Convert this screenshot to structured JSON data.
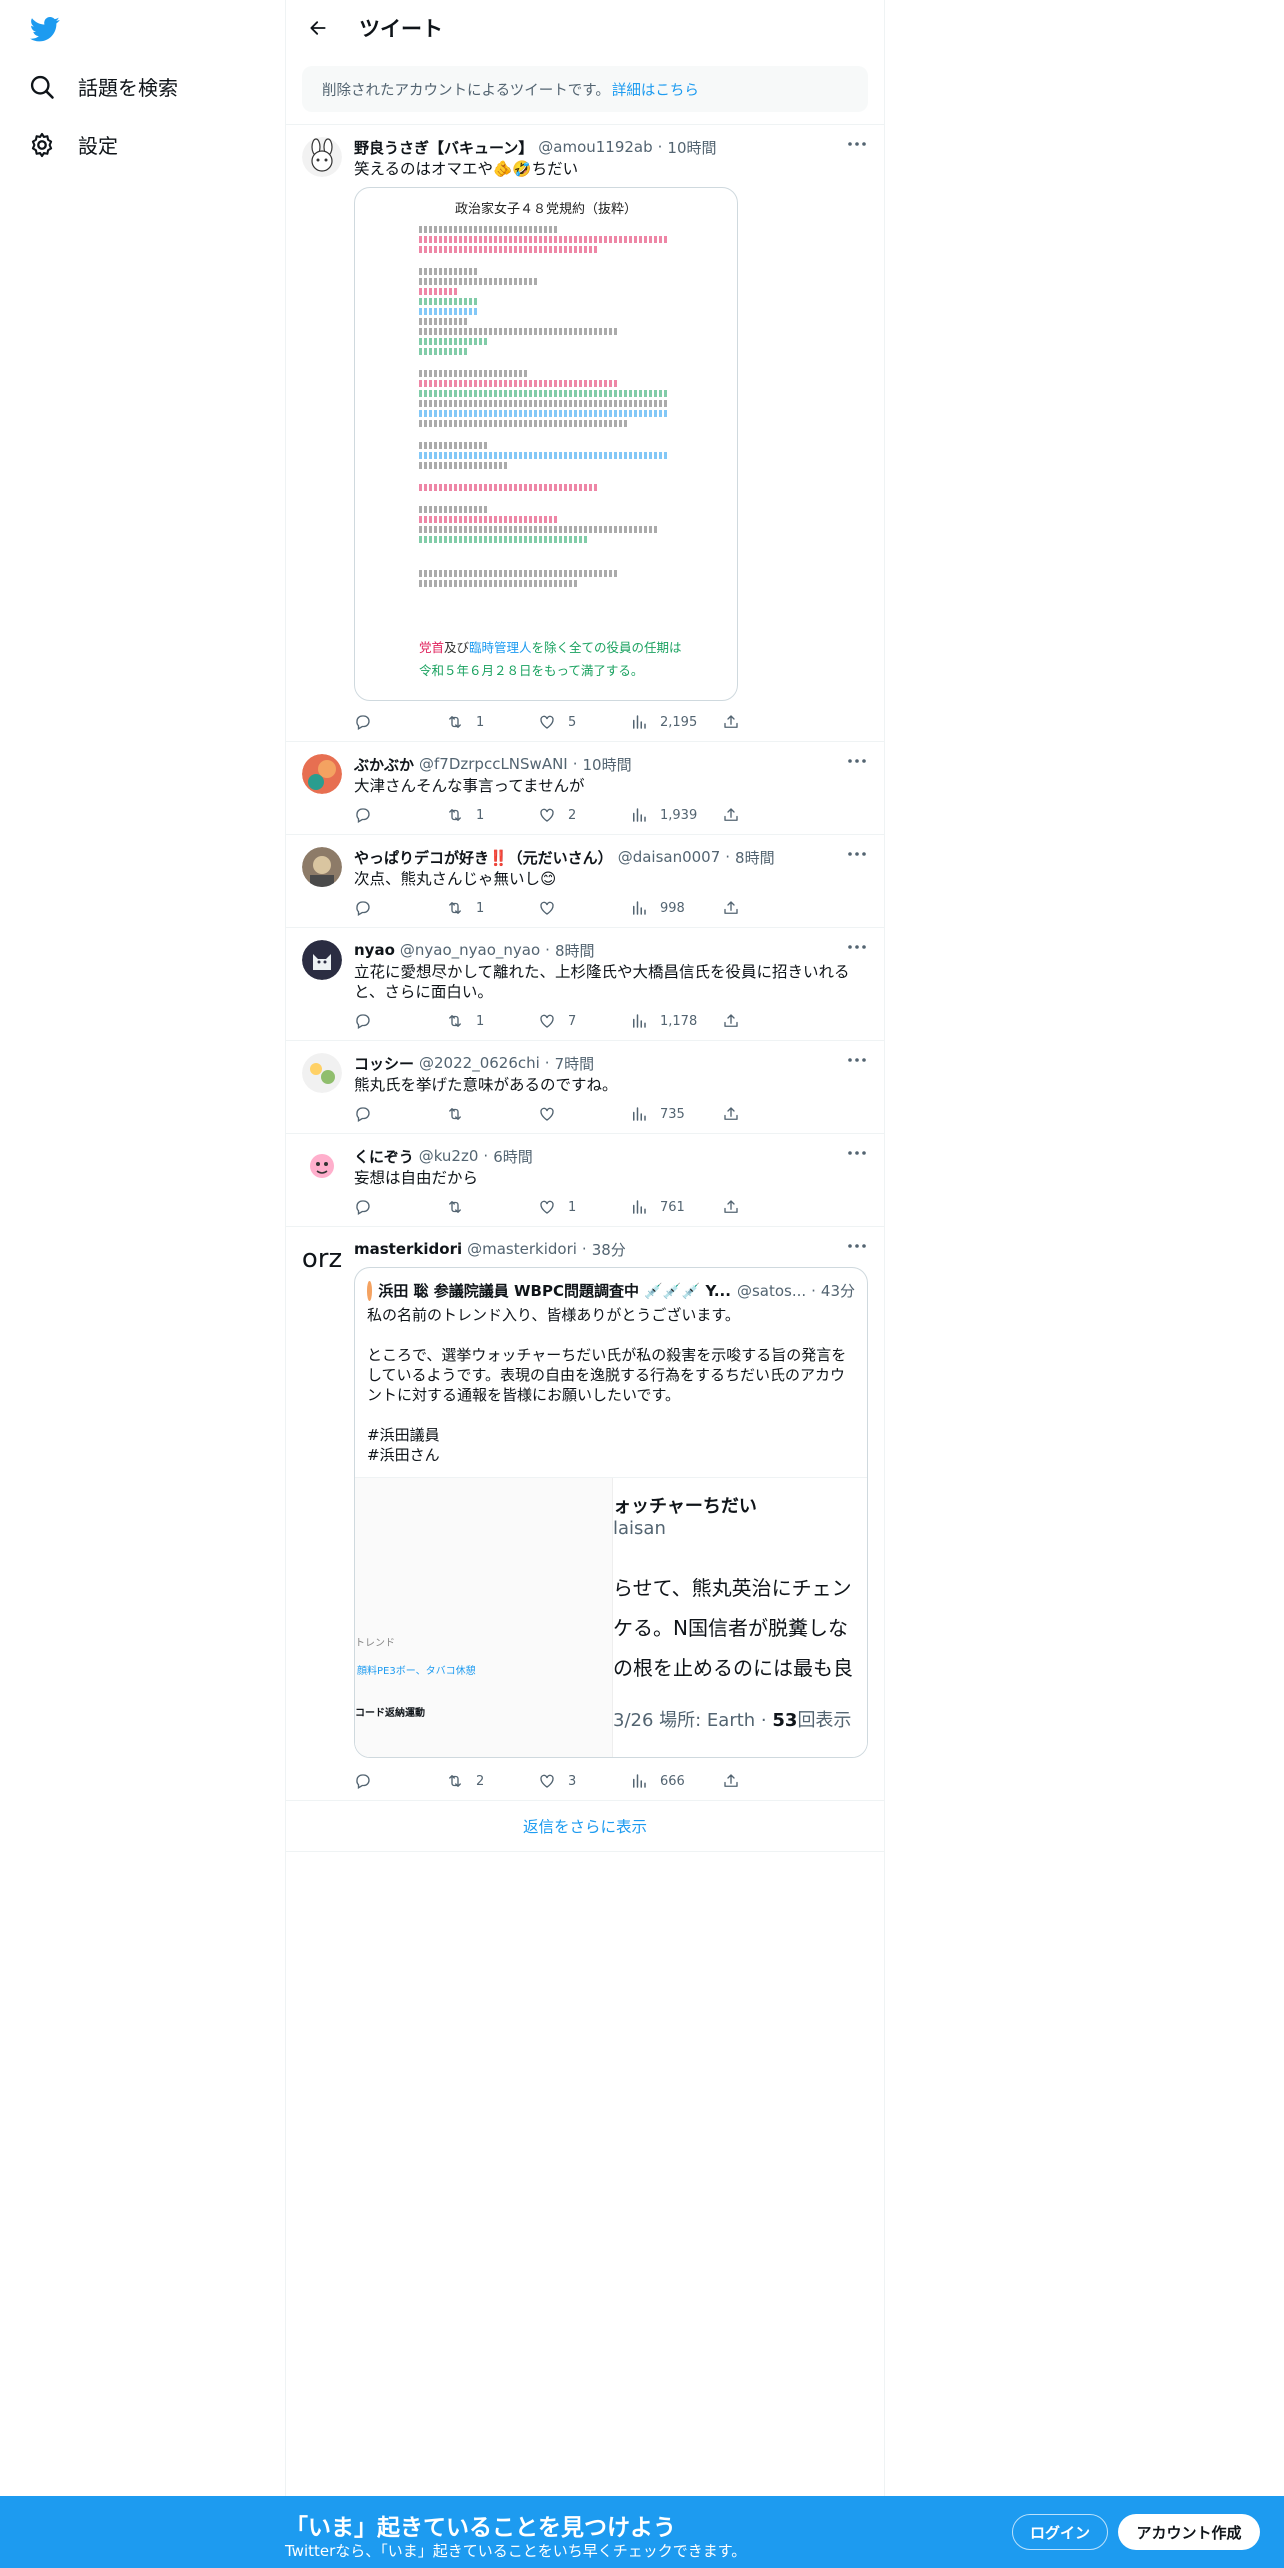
{
  "sidebar": {
    "explore_label": "話題を検索",
    "settings_label": "設定"
  },
  "header": {
    "title": "ツイート"
  },
  "notice": {
    "text": "削除されたアカウントによるツイートです。",
    "link": "詳細はこちら"
  },
  "tweets": [
    {
      "name": "野良うさぎ【バキューン】",
      "handle": "@amou1192ab",
      "time": "10時間",
      "text": "笑えるのはオマエや🫵🤣ちだい",
      "reply": "",
      "retweet": "1",
      "like": "5",
      "views": "2,195",
      "document": {
        "title": "政治家女子４８党規約（抜粋）",
        "line1_red": "党首",
        "line1_and": "及び",
        "line1_blue": "臨時管理人",
        "line1_rest": "を除く全ての役員の任期は",
        "line2": "令和５年６月２８日をもって満了する。"
      }
    },
    {
      "name": "ぶかぶか",
      "handle": "@f7DzrpccLNSwANI",
      "time": "10時間",
      "text": "大津さんそんな事言ってませんが",
      "reply": "",
      "retweet": "1",
      "like": "2",
      "views": "1,939"
    },
    {
      "name": "やっぱりデコが好き‼️（元だいさん）",
      "handle": "@daisan0007",
      "time": "8時間",
      "text": "次点、熊丸さんじゃ無いし😊",
      "reply": "",
      "retweet": "1",
      "like": "",
      "views": "998"
    },
    {
      "name": "nyao",
      "handle": "@nyao_nyao_nyao",
      "time": "8時間",
      "text": "立花に愛想尽かして離れた、上杉隆氏や大橋昌信氏を役員に招きいれると、さらに面白い。",
      "reply": "",
      "retweet": "1",
      "like": "7",
      "views": "1,178"
    },
    {
      "name": "コッシー",
      "handle": "@2022_0626chi",
      "time": "7時間",
      "text": "熊丸氏を挙げた意味があるのですね。",
      "reply": "",
      "retweet": "",
      "like": "",
      "views": "735"
    },
    {
      "name": "くにぞう",
      "handle": "@ku2z0",
      "time": "6時間",
      "text": "妄想は自由だから",
      "reply": "",
      "retweet": "",
      "like": "1",
      "views": "761"
    },
    {
      "name": "masterkidori",
      "handle": "@masterkidori",
      "time": "38分",
      "avatar_text": "orz",
      "text": "",
      "reply": "",
      "retweet": "2",
      "like": "3",
      "views": "666",
      "quote": {
        "name": "浜田 聡 参議院議員 WBPC問題調査中 💉💉💉 Y...",
        "handle": "@satos...",
        "time": "43分",
        "text": "私の名前のトレンド入り、皆様ありがとうございます。\n\nところで、選挙ウォッチャーちだい氏が私の殺害を示唆する旨の発言をしているようです。表現の自由を逸脱する行為をするちだい氏のアカウントに対する通報を皆様にお願いしたいです。\n\n#浜田議員\n#浜田さん",
        "img_title": "ォッチャーちだい",
        "img_handle": "laisan",
        "img_body": "らせて、熊丸英治にチェン\nケる。N国信者が脱糞しな\nの根を止めるのには最も良",
        "img_meta_prefix": "3/26 場所: Earth · ",
        "img_meta_count": "53",
        "img_meta_suffix": "回表示",
        "img_left1": "トレンド",
        "img_left2": "顔料PE3ボー、タバコ休憩",
        "img_left3": "コード返納運動"
      }
    }
  ],
  "show_more": "返信をさらに表示",
  "banner": {
    "title": "「いま」起きていることを見つけよう",
    "subtitle": "Twitterなら、「いま」起きていることをいち早くチェックできます。",
    "login": "ログイン",
    "signup": "アカウント作成"
  },
  "colors": {
    "accent": "#1d9bf0",
    "text": "#0f1419",
    "muted": "#536471"
  }
}
